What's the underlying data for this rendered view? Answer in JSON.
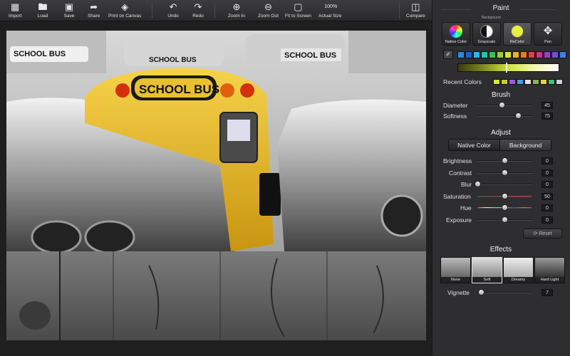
{
  "toolbar": {
    "import": "Import",
    "load": "Load",
    "save": "Save",
    "share": "Share",
    "print": "Print on Canvas",
    "undo": "Undo",
    "redo": "Redo",
    "zoom_in": "Zoom In",
    "zoom_out": "Zoom Out",
    "fit": "Fit to Screen",
    "actual": "Actual Size",
    "compare": "Compare"
  },
  "paint": {
    "title": "Paint",
    "background_tag": "Background",
    "modes": [
      "Native Color",
      "Grayscale",
      "ReColor",
      "Pan"
    ],
    "active_mode": "ReColor",
    "swatches": [
      "#2a8be0",
      "#1e5fd0",
      "#2fb4e8",
      "#28c2b0",
      "#38c050",
      "#9acd32",
      "#e0e030",
      "#f0b020",
      "#f07820",
      "#e84040",
      "#d03090",
      "#a040c0",
      "#7050d0",
      "#4080e8"
    ],
    "recent_label": "Recent Colors",
    "recent": [
      "#d8e838",
      "#c8d020",
      "#9a60d0",
      "#40a0e0",
      "#e0e0e0",
      "#8ab060",
      "#e8d040",
      "#40c080",
      "#d0d0d0"
    ]
  },
  "brush": {
    "title": "Brush",
    "diameter_label": "Diameter",
    "diameter": "45",
    "diameter_level": 0.45,
    "softness_label": "Softness",
    "softness": "75",
    "softness_level": 0.75
  },
  "adjust": {
    "title": "Adjust",
    "tabs": [
      "Native Color",
      "Background"
    ],
    "brightness_label": "Brightness",
    "brightness": "0",
    "contrast_label": "Contrast",
    "contrast": "0",
    "blur_label": "Blur",
    "blur": "0",
    "saturation_label": "Saturation",
    "saturation": "50",
    "hue_label": "Hue",
    "hue": "0",
    "exposure_label": "Exposure",
    "exposure": "0",
    "reset": "Reset"
  },
  "effects": {
    "title": "Effects",
    "items": [
      "None",
      "Soft",
      "Dreamy",
      "Hard Light"
    ],
    "selected": "Soft",
    "vignette_label": "Vignette",
    "vignette": "7",
    "vignette_level": 0.07
  },
  "photo_text": "SCHOOL BUS",
  "bg_bus_text": "SCHOOL BUS"
}
